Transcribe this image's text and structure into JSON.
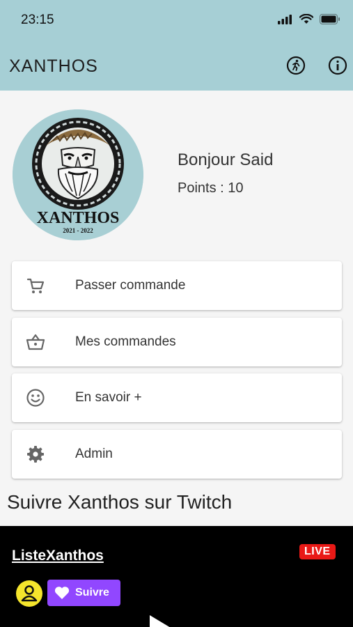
{
  "status_bar": {
    "time": "23:15"
  },
  "app": {
    "title": "XANTHOS"
  },
  "header_icons": [
    "running-person-icon",
    "info-icon"
  ],
  "profile": {
    "logo_text": "XANTHOS",
    "logo_years": "2021 - 2022",
    "greeting": "Bonjour Said",
    "points": "Points : 10"
  },
  "menu": [
    {
      "label": "Passer commande",
      "icon": "shopping-cart-icon"
    },
    {
      "label": "Mes commandes",
      "icon": "basket-icon"
    },
    {
      "label": "En savoir +",
      "icon": "smiley-icon"
    },
    {
      "label": "Admin",
      "icon": "gear-icon"
    }
  ],
  "twitch": {
    "heading": "Suivre Xanthos sur Twitch",
    "channel": "ListeXanthos",
    "live_badge": "LIVE",
    "follow_label": "Suivre"
  },
  "colors": {
    "header": "#a6cfd5",
    "twitch_purple": "#9147ff",
    "live_red": "#e91916"
  }
}
